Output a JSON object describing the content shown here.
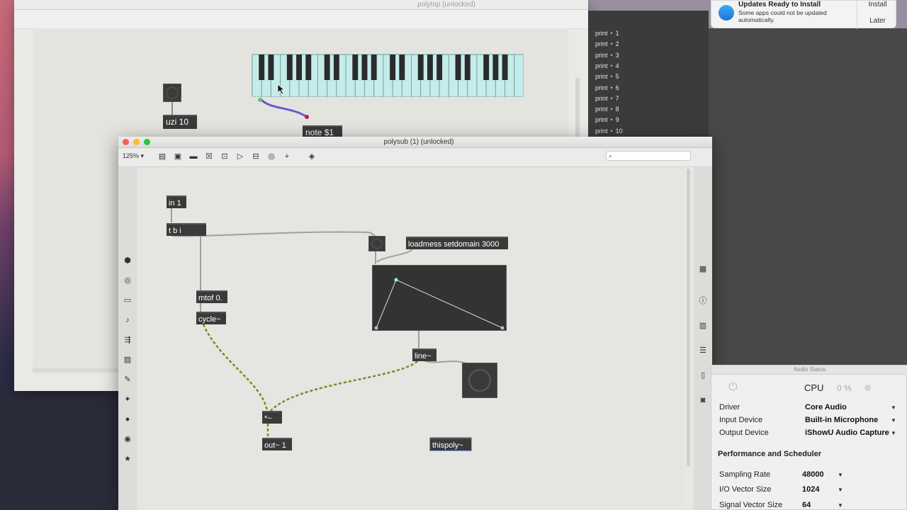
{
  "desktop": {},
  "back_window": {
    "title": "polytop (unlocked)",
    "objects": {
      "uzi": "uzi 10",
      "note": "note $1"
    }
  },
  "console": {
    "lines": [
      {
        "label": "print",
        "value": "1"
      },
      {
        "label": "print",
        "value": "2"
      },
      {
        "label": "print",
        "value": "3"
      },
      {
        "label": "print",
        "value": "4"
      },
      {
        "label": "print",
        "value": "5"
      },
      {
        "label": "print",
        "value": "6"
      },
      {
        "label": "print",
        "value": "7"
      },
      {
        "label": "print",
        "value": "8"
      },
      {
        "label": "print",
        "value": "9"
      },
      {
        "label": "print",
        "value": "10"
      }
    ]
  },
  "notification": {
    "title": "Updates Ready to Install",
    "body": "Some apps could not be updated automatically.",
    "install": "Install",
    "later": "Later"
  },
  "front_window": {
    "title": "polysub (1) (unlocked)",
    "zoom": "125% ▾",
    "objects": {
      "in": "in 1",
      "trigger": "t b i",
      "loadmess": "loadmess setdomain 3000",
      "mtof": "mtof 0.",
      "cycle": "cycle~",
      "line": "line~",
      "mult": "*~",
      "out": "out~ 1",
      "thispoly": "thispoly~"
    }
  },
  "audio_status": {
    "title": "Audio Status",
    "cpu_label": "CPU",
    "cpu_value": "0 %",
    "driver_label": "Driver",
    "driver_value": "Core Audio",
    "input_label": "Input Device",
    "input_value": "Built-in Microphone",
    "output_label": "Output Device",
    "output_value": "iShowU Audio Capture",
    "section": "Performance and Scheduler",
    "sr_label": "Sampling Rate",
    "sr_value": "48000",
    "io_label": "I/O Vector Size",
    "io_value": "1024",
    "sv_label": "Signal Vector Size",
    "sv_value": "64"
  },
  "colors": {
    "patch_bg": "#e5e5e1",
    "object_bg": "#3a3a3a",
    "signal_cord": "#9acd32",
    "keyboard": "#c3ecea",
    "cord_purple": "#6a5acd"
  }
}
